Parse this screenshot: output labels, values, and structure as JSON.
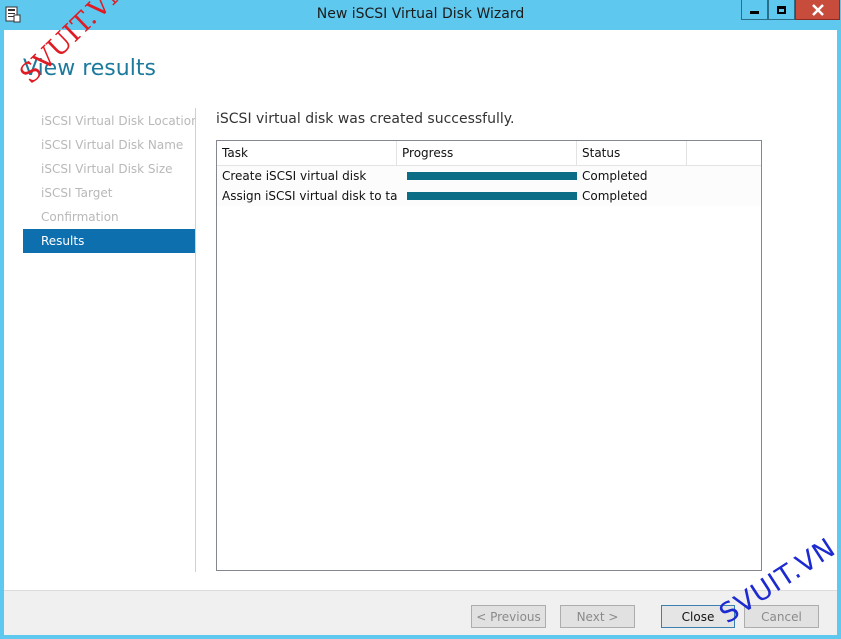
{
  "window": {
    "title": "New iSCSI Virtual Disk Wizard",
    "icon": "wizard-app-icon"
  },
  "page": {
    "heading": "View results",
    "result_message": "iSCSI virtual disk was created successfully."
  },
  "nav": {
    "items": [
      {
        "label": "iSCSI Virtual Disk Location",
        "active": false
      },
      {
        "label": "iSCSI Virtual Disk Name",
        "active": false
      },
      {
        "label": "iSCSI Virtual Disk Size",
        "active": false
      },
      {
        "label": "iSCSI Target",
        "active": false
      },
      {
        "label": "Confirmation",
        "active": false
      },
      {
        "label": "Results",
        "active": true
      }
    ]
  },
  "grid": {
    "columns": [
      "Task",
      "Progress",
      "Status",
      ""
    ],
    "rows": [
      {
        "task": "Create iSCSI virtual disk",
        "progress": 1.0,
        "status": "Completed"
      },
      {
        "task": "Assign iSCSI virtual disk to target",
        "progress": 1.0,
        "status": "Completed"
      }
    ]
  },
  "footer": {
    "previous_label": "< Previous",
    "next_label": "Next >",
    "close_label": "Close",
    "cancel_label": "Cancel"
  },
  "watermarks": {
    "top_left": "SVUIT.VN",
    "bottom_right": "SVUIT.VN"
  },
  "colors": {
    "titlebar": "#5ec8ee",
    "heading": "#1e7a9c",
    "active_nav": "#0e6fae",
    "progress_fill": "#0b6e86",
    "close_button": "#c74c3c"
  }
}
